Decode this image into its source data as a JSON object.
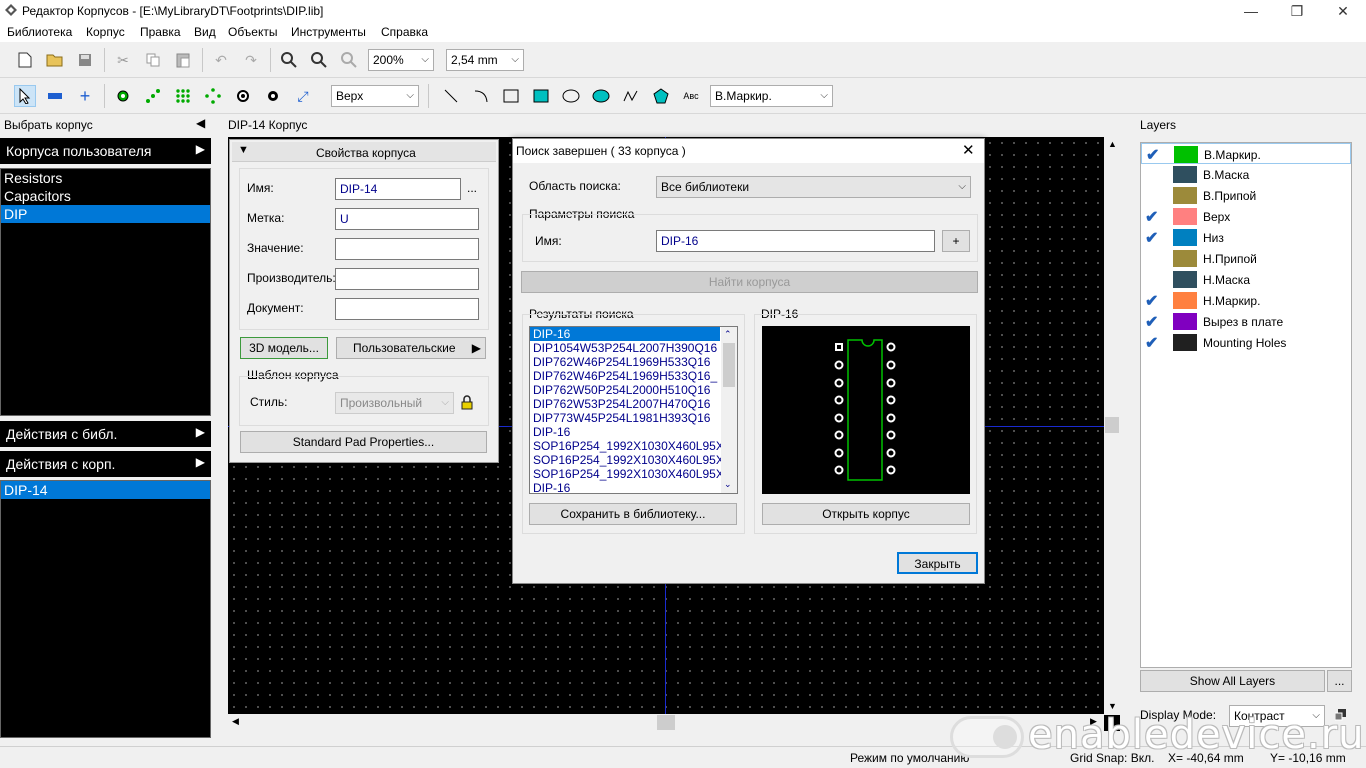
{
  "window": {
    "title": "Редактор Корпусов - [E:\\MyLibraryDT\\Footprints\\DIP.lib]",
    "min": "—",
    "max": "❐",
    "close": "✕"
  },
  "menu": [
    "Библиотека",
    "Корпус",
    "Правка",
    "Вид",
    "Объекты",
    "Инструменты",
    "Справка"
  ],
  "toolbar1": {
    "zoom": "200%",
    "grid": "2,54 mm"
  },
  "toolbar2": {
    "layer_select": "Верх",
    "marking_select": "В.Маркир.",
    "text_tool": "Авс"
  },
  "left": {
    "select_header": "Выбрать корпус",
    "user_footprints": "Корпуса пользователя",
    "libraries": [
      "Resistors",
      "Capacitors",
      "DIP"
    ],
    "lib_actions": "Действия с библ.",
    "fp_actions": "Действия с корп.",
    "footprints": [
      "DIP-14"
    ]
  },
  "canvas": {
    "tab_title": "DIP-14 Корпус"
  },
  "props": {
    "header": "Свойства корпуса",
    "name_label": "Имя:",
    "name_value": "DIP-14",
    "dots": "...",
    "mark_label": "Метка:",
    "mark_value": "U",
    "value_label": "Значение:",
    "value_value": "",
    "mfr_label": "Производитель:",
    "mfr_value": "",
    "doc_label": "Документ:",
    "doc_value": "",
    "model3d_btn": "3D модель...",
    "custom_btn": "Пользовательские",
    "template_group": "Шаблон корпуса",
    "style_label": "Стиль:",
    "style_value": "Произвольный",
    "pad_btn": "Standard Pad Properties..."
  },
  "dialog": {
    "title": "Поиск завершен  ( 33 корпуса )",
    "area_label": "Область поиска:",
    "area_value": "Все библиотеки",
    "params_group": "Параметры поиска",
    "name_label": "Имя:",
    "name_value": "DIP-16",
    "plus": "+",
    "find_btn": "Найти корпуса",
    "results_group": "Результаты поиска",
    "results": [
      "DIP-16",
      "DIP1054W53P254L2007H390Q16",
      "DIP762W46P254L1969H533Q16",
      "DIP762W46P254L1969H533Q16_",
      "DIP762W50P254L2000H510Q16",
      "DIP762W53P254L2007H470Q16",
      "DIP773W45P254L1981H393Q16",
      "DIP-16",
      "SOP16P254_1992X1030X460L95X",
      "SOP16P254_1992X1030X460L95X",
      "SOP16P254_1992X1030X460L95X",
      "DIP-16"
    ],
    "preview_label": "DIP-16",
    "save_btn": "Сохранить в библиотеку...",
    "open_btn": "Открыть корпус",
    "close_btn": "Закрыть"
  },
  "layers": {
    "title": "Layers",
    "items": [
      {
        "name": "В.Маркир.",
        "checked": true,
        "color": "#00c000"
      },
      {
        "name": "В.Маска",
        "checked": false,
        "color": "#2f4f5f"
      },
      {
        "name": "В.Припой",
        "checked": false,
        "color": "#9c8a3a"
      },
      {
        "name": "Верх",
        "checked": true,
        "color": "#ff8080"
      },
      {
        "name": "Низ",
        "checked": true,
        "color": "#0080c0"
      },
      {
        "name": "Н.Припой",
        "checked": false,
        "color": "#9c8a3a"
      },
      {
        "name": "Н.Маска",
        "checked": false,
        "color": "#2f4f5f"
      },
      {
        "name": "Н.Маркир.",
        "checked": true,
        "color": "#ff8040"
      },
      {
        "name": "Вырез в плате",
        "checked": true,
        "color": "#8000c0"
      },
      {
        "name": "Mounting Holes",
        "checked": true,
        "color": "#202020"
      }
    ],
    "check_mark": "✔",
    "show_all": "Show All Layers",
    "more": "...",
    "display_mode_label": "Display Mode:",
    "display_mode_value": "Контраст"
  },
  "status": {
    "mode": "Режим по умолчанию",
    "snap": "Grid Snap: Вкл.",
    "x": "X= -40,64 mm",
    "y": "Y= -10,16 mm"
  },
  "watermark": "enabledevice.ru"
}
